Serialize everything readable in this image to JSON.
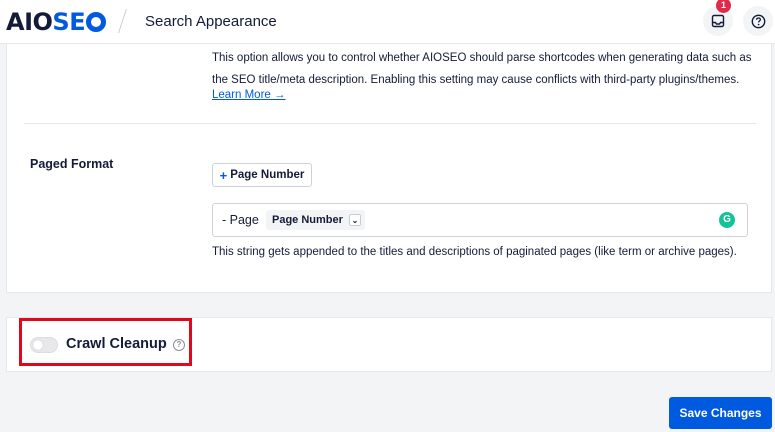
{
  "header": {
    "logo_part1": "AIO",
    "logo_part2": "SE",
    "page_title": "Search Appearance",
    "notification_count": "1",
    "notifications_icon": "inbox-icon",
    "help_icon": "question-circle-icon"
  },
  "shortcodes": {
    "description": "This option allows you to control whether AIOSEO should parse shortcodes when generating data such as the SEO title/meta description. Enabling this setting may cause conflicts with third-party plugins/themes.",
    "learn_more": "Learn More →"
  },
  "paged_format": {
    "label": "Paged Format",
    "add_tag_plus": "+",
    "add_tag_label": "Page Number",
    "input_text": "- Page",
    "input_tag": "Page Number",
    "input_tag_caret": "⌄",
    "grammarly_icon": "grammarly-icon",
    "grammarly_glyph": "G",
    "help_text": "This string gets appended to the titles and descriptions of paginated pages (like term or archive pages)."
  },
  "crawl_cleanup": {
    "title": "Crawl Cleanup",
    "enabled": false,
    "help_glyph": "?"
  },
  "footer": {
    "save_label": "Save Changes"
  },
  "colors": {
    "brand_blue": "#005ae0",
    "text_dark": "#141b38",
    "highlight_red": "#e0081c",
    "badge_red": "#df2a4a",
    "grammarly_green": "#15c39a"
  }
}
